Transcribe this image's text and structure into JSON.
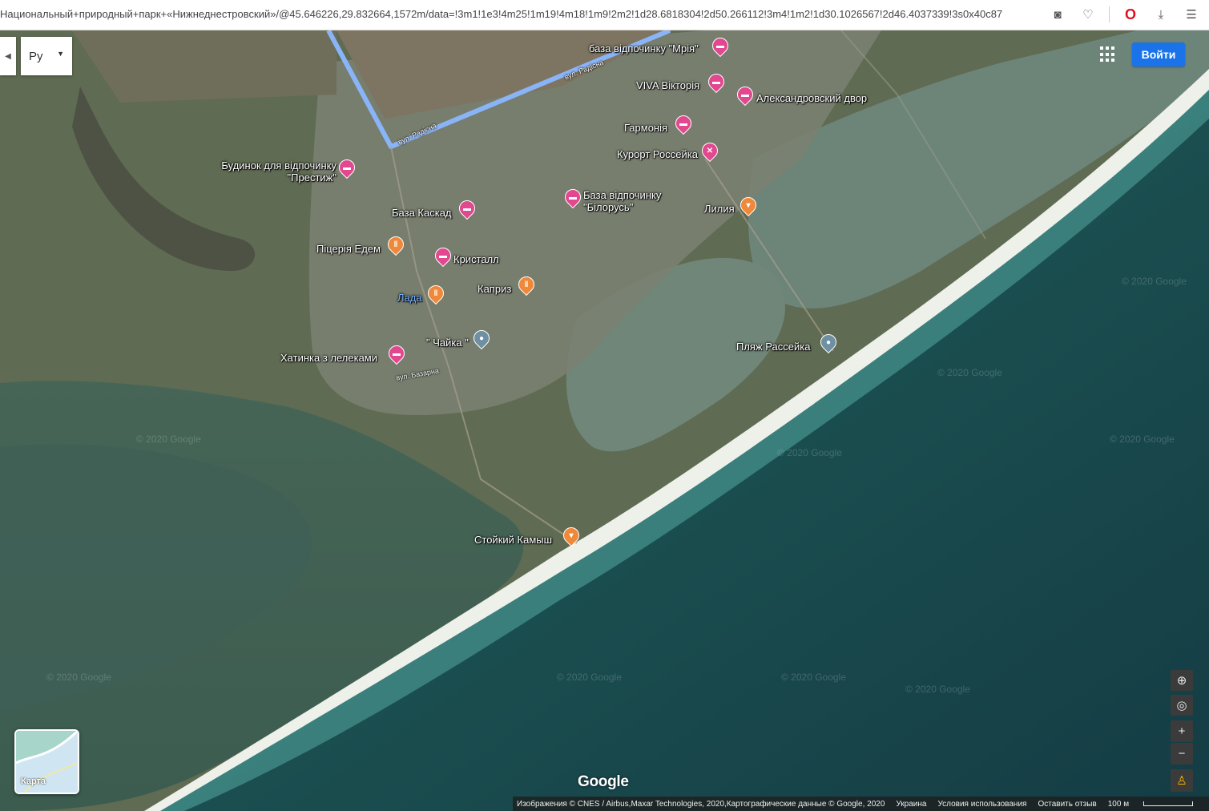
{
  "browser": {
    "url": "Национальный+природный+парк+«Нижнеднестровский»/@45.646226,29.832664,1572m/data=!3m1!1e3!4m25!1m19!4m18!1m9!2m2!1d28.6818304!2d50.266112!3m4!1m2!1d30.1026567!2d46.4037339!3s0x40c87",
    "icons": [
      "camera-icon",
      "heart-icon",
      "opera-icon",
      "download-icon",
      "menu-icon"
    ]
  },
  "controls": {
    "language_value": "Ру",
    "signin_label": "Войти",
    "minimap_label": "Карта",
    "zoom_in": "+",
    "zoom_out": "−"
  },
  "places": [
    {
      "id": "mriya",
      "name": "база відпочинку \"Мрія\"",
      "type": "hotel"
    },
    {
      "id": "viva",
      "name": "VIVA Вікторія",
      "type": "hotel"
    },
    {
      "id": "aleks",
      "name": "Александровский двор",
      "type": "hotel"
    },
    {
      "id": "garmonia",
      "name": "Гармонія",
      "type": "hotel"
    },
    {
      "id": "rosseyka",
      "name": "Курорт Россейка",
      "type": "shop"
    },
    {
      "id": "prestizh",
      "name": "Будинок для відпочинку \"Престиж\"",
      "type": "hotel"
    },
    {
      "id": "belarus",
      "name": "База відпочинку \"Білорусь\"",
      "type": "hotel"
    },
    {
      "id": "liliya",
      "name": "Лилия",
      "type": "food"
    },
    {
      "id": "kaskad",
      "name": "База Каскад",
      "type": "hotel"
    },
    {
      "id": "edem",
      "name": "Піцерія Едем",
      "type": "food"
    },
    {
      "id": "kristall",
      "name": "Кристалл",
      "type": "hotel"
    },
    {
      "id": "kapriz",
      "name": "Каприз",
      "type": "food"
    },
    {
      "id": "lada",
      "name": "Лада",
      "type": "food"
    },
    {
      "id": "chayka",
      "name": "\" Чайка \"",
      "type": "poi"
    },
    {
      "id": "plyazh",
      "name": "Пляж Рассейка",
      "type": "poi"
    },
    {
      "id": "khatynka",
      "name": "Хатинка з лелеками",
      "type": "hotel"
    },
    {
      "id": "kamysh",
      "name": "Стойкий Камыш",
      "type": "food"
    }
  ],
  "streets": [
    "вул. Радісна",
    "вул. Радісна",
    "вул. Базарна"
  ],
  "watermark": "© 2020 Google",
  "logo": "Google",
  "footer": {
    "imagery": "Изображения © CNES / Airbus,Maxar Technologies, 2020,Картографические данные © Google, 2020",
    "region": "Украина",
    "terms": "Условия использования",
    "feedback": "Оставить отзыв",
    "scale": "100 м"
  },
  "colors": {
    "sea_deep": "#163f45",
    "sea_shallow": "#2c6a6c",
    "sand": "#e9ece6",
    "land": "#5d6a4e",
    "lagoon": "#4e6f63",
    "route": "#8ab4f8",
    "accent": "#1a73e8"
  }
}
